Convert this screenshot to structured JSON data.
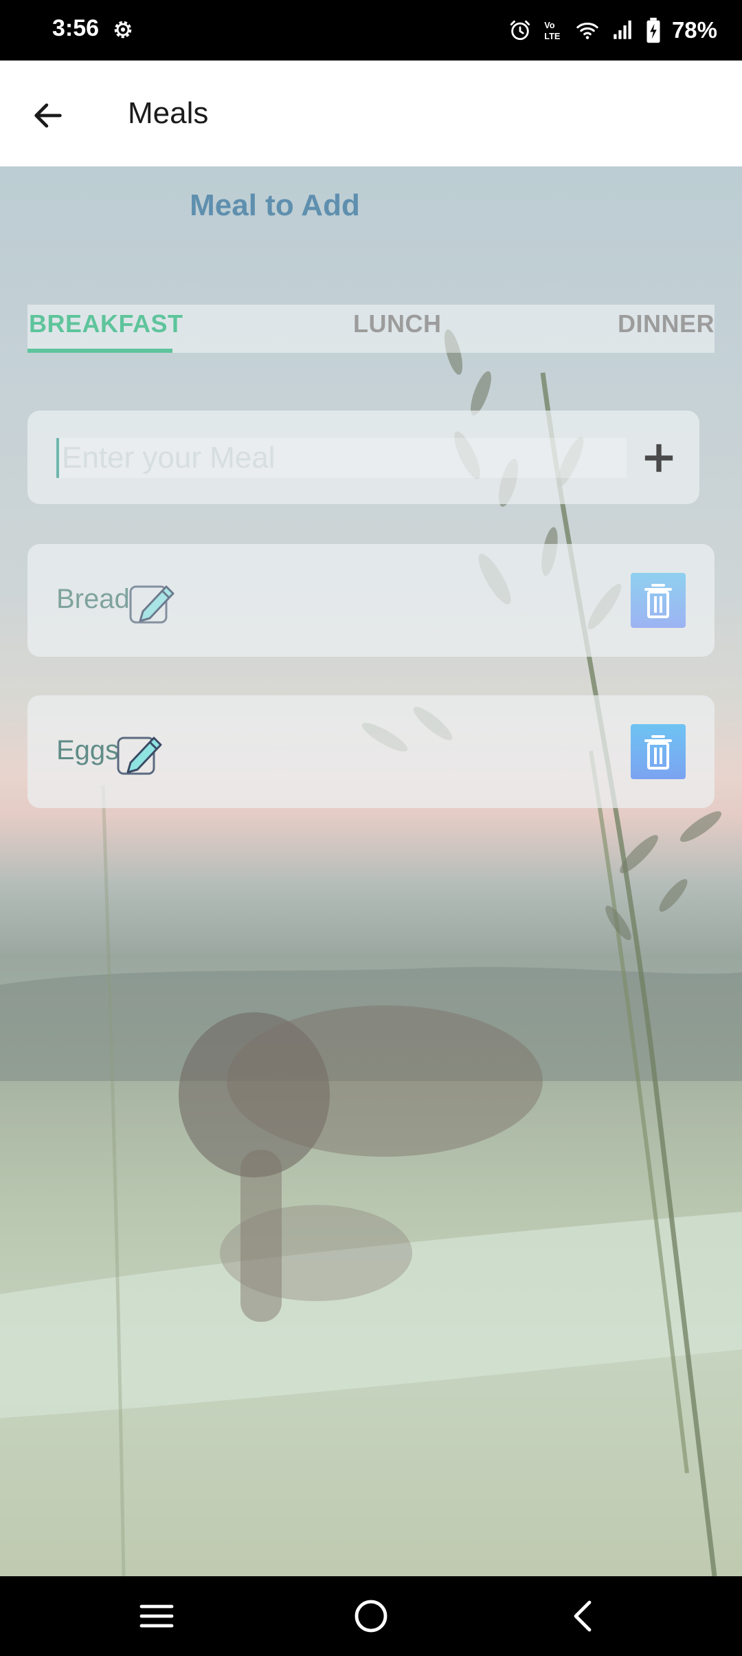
{
  "status_bar": {
    "time": "3:56",
    "battery": "78%",
    "icons": [
      "gear-icon",
      "alarm-icon",
      "volte-icon",
      "wifi-icon",
      "signal-icon",
      "battery-charging-icon"
    ]
  },
  "app_bar": {
    "title": "Meals",
    "back_icon": "arrow-left-icon"
  },
  "main": {
    "heading": "Meal to Add",
    "tabs": [
      {
        "label": "BREAKFAST",
        "selected": true
      },
      {
        "label": "LUNCH",
        "selected": false
      },
      {
        "label": "DINNER",
        "selected": false
      }
    ],
    "input": {
      "placeholder": "Enter your Meal",
      "value": "",
      "add_icon": "plus-icon"
    },
    "meals": [
      {
        "name": "Bread",
        "edit_icon": "edit-pencil-icon",
        "delete_icon": "trash-icon"
      },
      {
        "name": "Eggs",
        "edit_icon": "edit-pencil-icon",
        "delete_icon": "trash-icon"
      }
    ]
  },
  "nav_bar": {
    "icons": [
      "recents-icon",
      "home-icon",
      "back-icon"
    ]
  },
  "colors": {
    "accent": "#5ec49b",
    "heading": "#5f8fae",
    "delete_button": "#7ba3f1",
    "inactive_tab": "#9c9c9c"
  }
}
